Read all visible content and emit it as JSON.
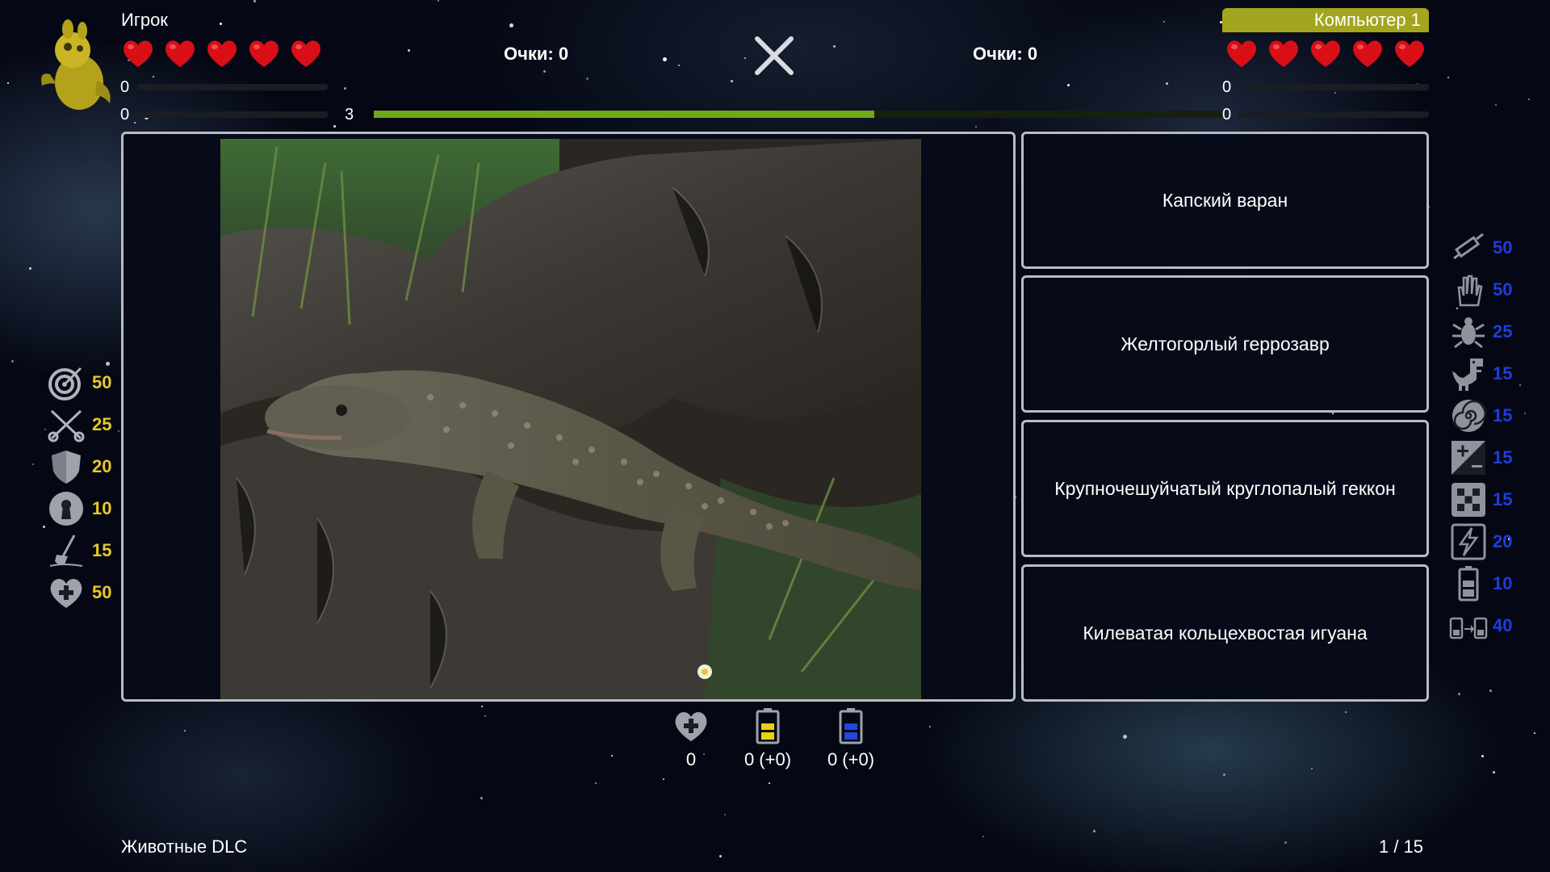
{
  "player": {
    "name": "Игрок",
    "lives": 5,
    "score_label": "Очки: 0",
    "stat_top": "0",
    "stat_bottom": "0",
    "stat_bottom_right": "3"
  },
  "opponent": {
    "name": "Компьютер 1",
    "lives": 5,
    "score_label": "Очки: 0",
    "stat_top": "0",
    "stat_bottom": "0"
  },
  "timer": {
    "progress": 0.59
  },
  "question": {
    "image_alt": "lizard-photo",
    "answers": [
      "Капский варан",
      "Желтогорлый геррозавр",
      "Крупночешуйчатый круглопалый геккон",
      "Килеватая кольцехвостая игуана"
    ]
  },
  "player_bonuses": [
    {
      "icon": "target-icon",
      "value": "50"
    },
    {
      "icon": "crossed-arrows-icon",
      "value": "25"
    },
    {
      "icon": "shield-icon",
      "value": "20"
    },
    {
      "icon": "keyhole-icon",
      "value": "10"
    },
    {
      "icon": "shovel-icon",
      "value": "15"
    },
    {
      "icon": "heart-plus-icon",
      "value": "50"
    }
  ],
  "opponent_bonuses": [
    {
      "icon": "syringe-icon",
      "value": "50"
    },
    {
      "icon": "hand-icon",
      "value": "50"
    },
    {
      "icon": "bug-icon",
      "value": "25"
    },
    {
      "icon": "dinosaur-icon",
      "value": "15"
    },
    {
      "icon": "spiral-icon",
      "value": "15"
    },
    {
      "icon": "plus-minus-icon",
      "value": "15"
    },
    {
      "icon": "dice-icon",
      "value": "15"
    },
    {
      "icon": "lightning-icon",
      "value": "20"
    },
    {
      "icon": "battery-icon",
      "value": "10"
    },
    {
      "icon": "battery-transfer-icon",
      "value": "40"
    }
  ],
  "items": [
    {
      "icon": "heart-plus-icon",
      "value": "0"
    },
    {
      "icon": "yellow-battery-icon",
      "value": "0 (+0)"
    },
    {
      "icon": "blue-battery-icon",
      "value": "0 (+0)"
    }
  ],
  "footer": {
    "pack_name": "Животные DLC",
    "progress": "1 / 15"
  },
  "colors": {
    "heart": "#d90f17",
    "timer": "#6faa16",
    "opponent_tag": "#a3a51e",
    "player_bonus_value": "#e8c828",
    "opponent_bonus_value": "#1f3cdc"
  }
}
